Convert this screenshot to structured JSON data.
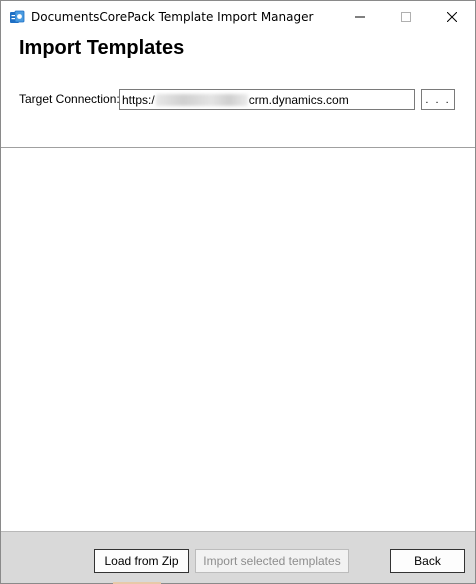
{
  "window": {
    "title": "DocumentsCorePack Template Import Manager",
    "app_icon": "documentscorepack-icon",
    "controls": {
      "minimize_icon": "minimize-icon",
      "maximize_icon": "maximize-icon",
      "close_icon": "close-icon"
    }
  },
  "header": {
    "title": "Import Templates",
    "connection_label": "Target Connection:",
    "connection_prefix": "https:/",
    "connection_suffix": "crm.dynamics.com",
    "browse_label": ". . ."
  },
  "footer": {
    "load_label": "Load from Zip",
    "import_label": "Import selected templates",
    "back_label": "Back"
  },
  "colors": {
    "footer_bg": "#d9d9d9",
    "disabled_text": "#8d8d8d",
    "icon_blue": "#1e6fc4"
  }
}
